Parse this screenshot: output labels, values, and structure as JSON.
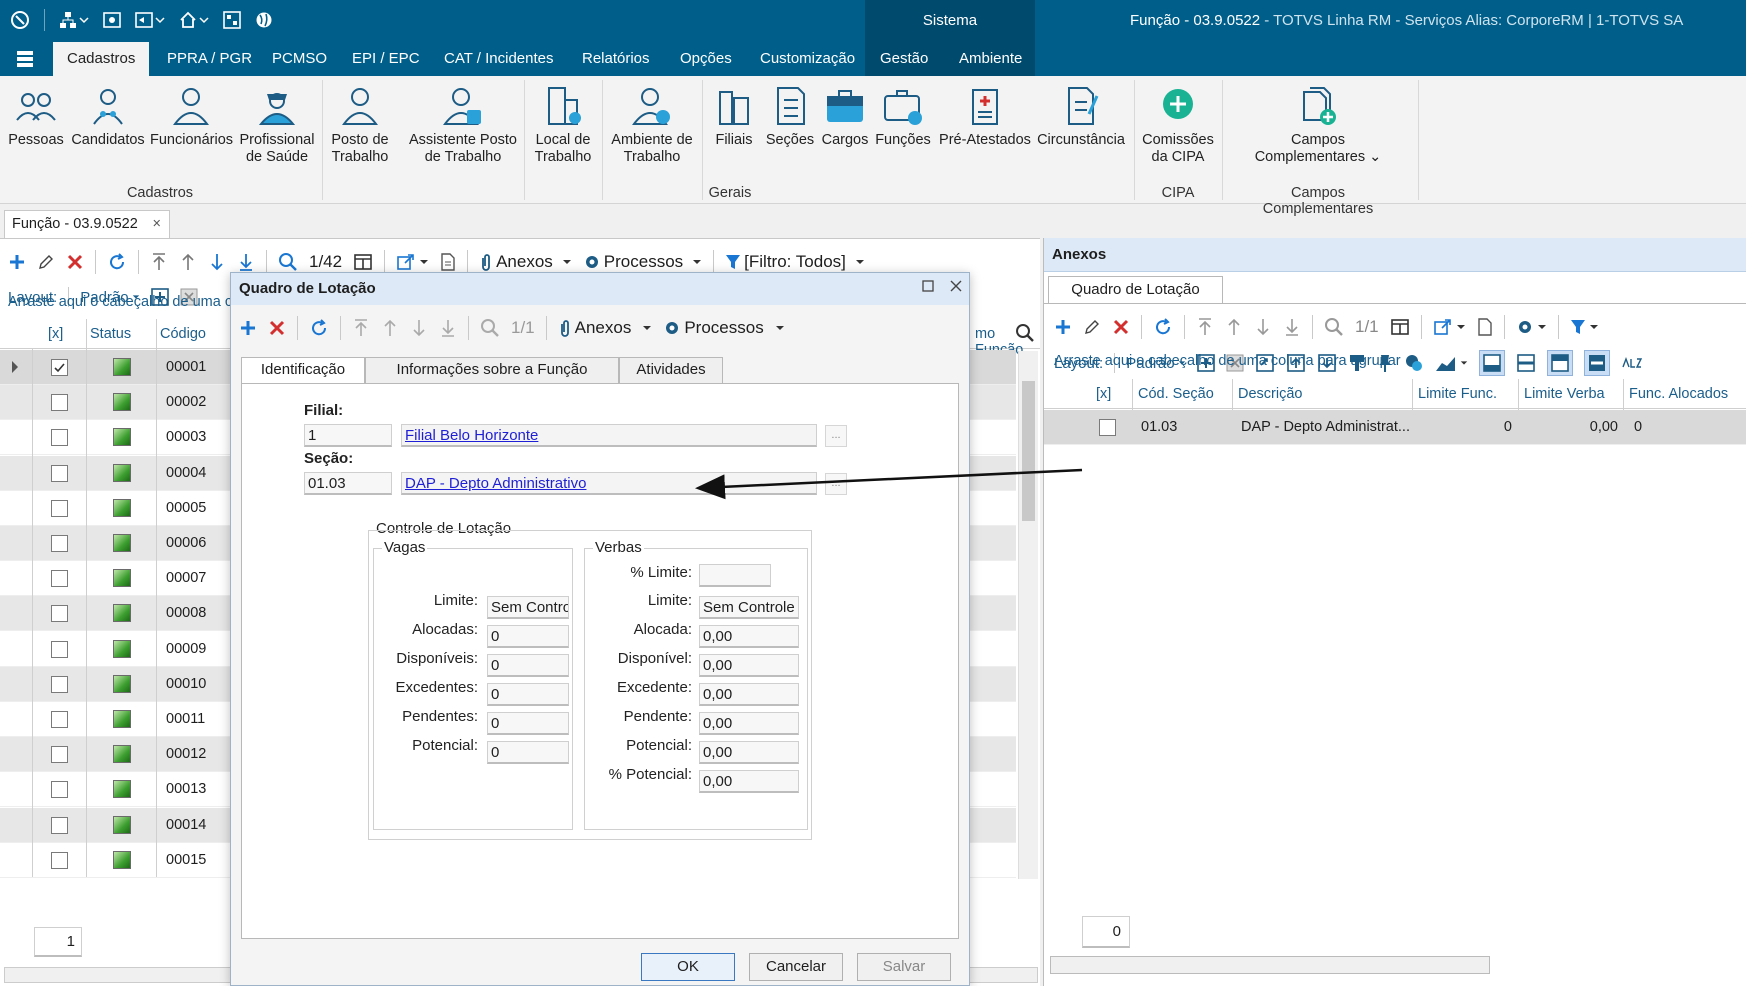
{
  "window": {
    "sistema_label": "Sistema",
    "title_main": "Função - 03.9.0522",
    "title_rest": " - TOTVS Linha RM - Serviços  Alias: CorporeRM | 1-TOTVS SA"
  },
  "menu": {
    "tabs": [
      "Cadastros",
      "PPRA / PGR",
      "PCMSO",
      "EPI / EPC",
      "CAT / Incidentes",
      "Relatórios",
      "Opções",
      "Customização",
      "Gestão",
      "Ambiente"
    ]
  },
  "ribbon": {
    "cadastros": [
      "Pessoas",
      "Candidatos",
      "Funcionários",
      "Profissional de Saúde"
    ],
    "cadastros_label": "Cadastros",
    "gerais": [
      "Posto de Trabalho",
      "Assistente Posto de Trabalho",
      "Local de Trabalho",
      "Ambiente de Trabalho",
      "Filiais",
      "Seções",
      "Cargos",
      "Funções",
      "Pré-Atestados",
      "Circunstância"
    ],
    "gerais_label": "Gerais",
    "cipa": [
      "Comissões da CIPA"
    ],
    "cipa_label": "CIPA",
    "campos": [
      "Campos Complementares"
    ],
    "campos_label": "Campos Complementares"
  },
  "doc_tab": {
    "label": "Função - 03.9.0522",
    "close": "×"
  },
  "left": {
    "record_counter": "1/42",
    "anexos": "Anexos",
    "processos": "Processos",
    "filtro": "[Filtro: Todos]",
    "layout_label": "Layout:",
    "layout_value": "Padrão",
    "group_hint": "Arraste aqui o cabeçalho de uma co",
    "cols": {
      "check": "[x]",
      "status": "Status",
      "codigo": "Código",
      "right_partial": "mo Função"
    },
    "rows": [
      "00001",
      "00002",
      "00003",
      "00004",
      "00005",
      "00006",
      "00007",
      "00008",
      "00009",
      "00010",
      "00011",
      "00012",
      "00013",
      "00014",
      "00015"
    ],
    "footer_value": "1"
  },
  "right": {
    "title": "Anexos",
    "tab": "Quadro de Lotação",
    "record_counter": "1/1",
    "layout_label": "Layout:",
    "layout_value": "Padrão",
    "group_hint": "Arraste aqui o cabeçalho de uma coluna para agrupar",
    "cols": {
      "check": "[x]",
      "cod_secao": "Cód. Seção",
      "descricao": "Descrição",
      "limite_func": "Limite Func.",
      "limite_verba": "Limite Verba",
      "func_alocados": "Func. Alocados"
    },
    "row": {
      "cod_secao": "01.03",
      "descricao": "DAP - Depto Administrat...",
      "limite_func": "0",
      "limite_verba": "0,00",
      "func_alocados": "0"
    },
    "footer_value": "0"
  },
  "dialog": {
    "title": "Quadro de Lotação",
    "record_counter": "1/1",
    "anexos": "Anexos",
    "processos": "Processos",
    "tabs": [
      "Identificação",
      "Informações sobre a Função",
      "Atividades"
    ],
    "filial_label": "Filial:",
    "filial_code": "1",
    "filial_name": "Filial Belo Horizonte",
    "secao_label": "Seção:",
    "secao_code": "01.03",
    "secao_name": "DAP - Depto Administrativo",
    "ellipsis": "...",
    "controle_label": "Controle de Lotação",
    "vagas": {
      "title": "Vagas",
      "fields": [
        {
          "label": "Limite:",
          "value": "Sem Controle"
        },
        {
          "label": "Alocadas:",
          "value": "0"
        },
        {
          "label": "Disponíveis:",
          "value": "0"
        },
        {
          "label": "Excedentes:",
          "value": "0"
        },
        {
          "label": "Pendentes:",
          "value": "0"
        },
        {
          "label": "Potencial:",
          "value": "0"
        }
      ]
    },
    "verbas": {
      "title": "Verbas",
      "pct_limite_label": "% Limite:",
      "pct_limite_value": "",
      "fields": [
        {
          "label": "Limite:",
          "value": "Sem Controle"
        },
        {
          "label": "Alocada:",
          "value": "0,00"
        },
        {
          "label": "Disponível:",
          "value": "0,00"
        },
        {
          "label": "Excedente:",
          "value": "0,00"
        },
        {
          "label": "Pendente:",
          "value": "0,00"
        },
        {
          "label": "Potencial:",
          "value": "0,00"
        },
        {
          "label": "% Potencial:",
          "value": "0,00"
        }
      ]
    },
    "buttons": {
      "ok": "OK",
      "cancel": "Cancelar",
      "save": "Salvar"
    }
  },
  "colors": {
    "brand": "#005f8a",
    "brand_dark": "#004a6e",
    "add": "#1976d2",
    "delete": "#d32f2f",
    "link": "#1f1fd6",
    "panel_title": "#dde9f6"
  }
}
